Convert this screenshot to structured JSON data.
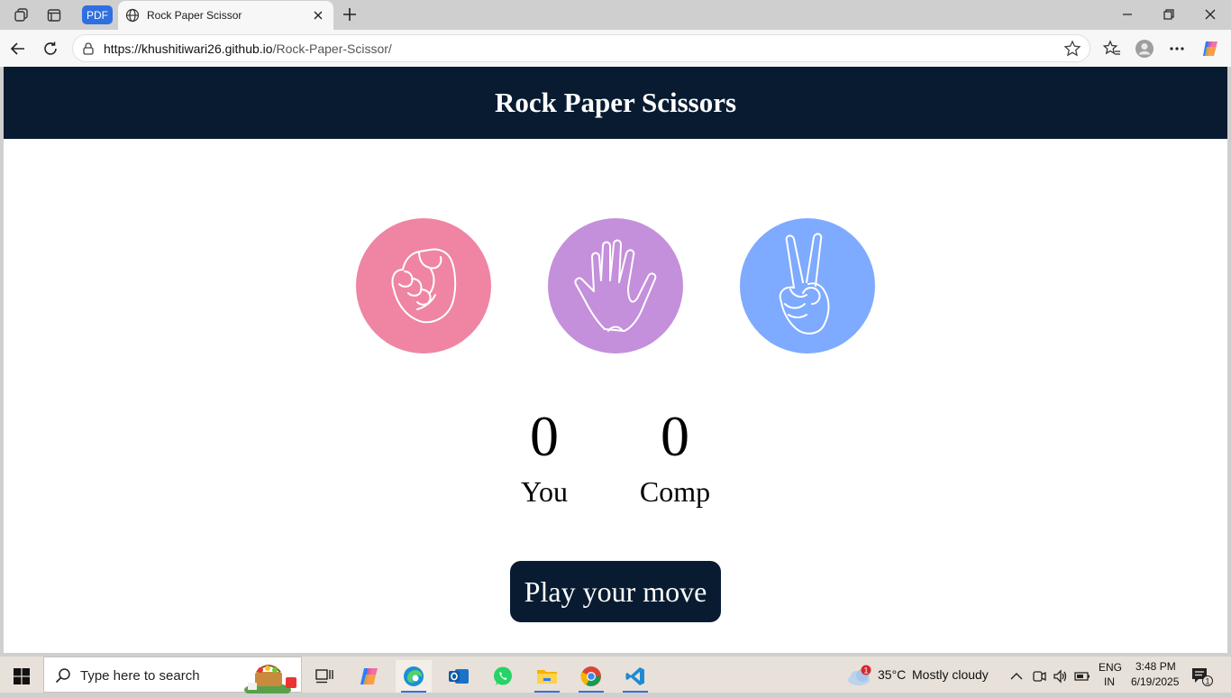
{
  "browser": {
    "pdf_label": "PDF",
    "tab_title": "Rock Paper Scissor",
    "url_host": "https://khushitiwari26.github.io",
    "url_path": "/Rock-Paper-Scissor/"
  },
  "page": {
    "title": "Rock Paper Scissors",
    "choices": [
      {
        "name": "rock",
        "color": "#ef85a2"
      },
      {
        "name": "paper",
        "color": "#c48fdb"
      },
      {
        "name": "scissors",
        "color": "#7eaaff"
      }
    ],
    "user_score": "0",
    "user_label": "You",
    "comp_score": "0",
    "comp_label": "Comp",
    "message": "Play your move"
  },
  "taskbar": {
    "search_placeholder": "Type here to search",
    "weather_temp": "35°C",
    "weather_desc": "Mostly cloudy",
    "weather_badge": "1",
    "lang_top": "ENG",
    "lang_bottom": "IN",
    "time": "3:48 PM",
    "date": "6/19/2025",
    "notif_count": "1"
  },
  "colors": {
    "header_bg": "#081b31",
    "accent_blue": "#2f6fe0"
  }
}
